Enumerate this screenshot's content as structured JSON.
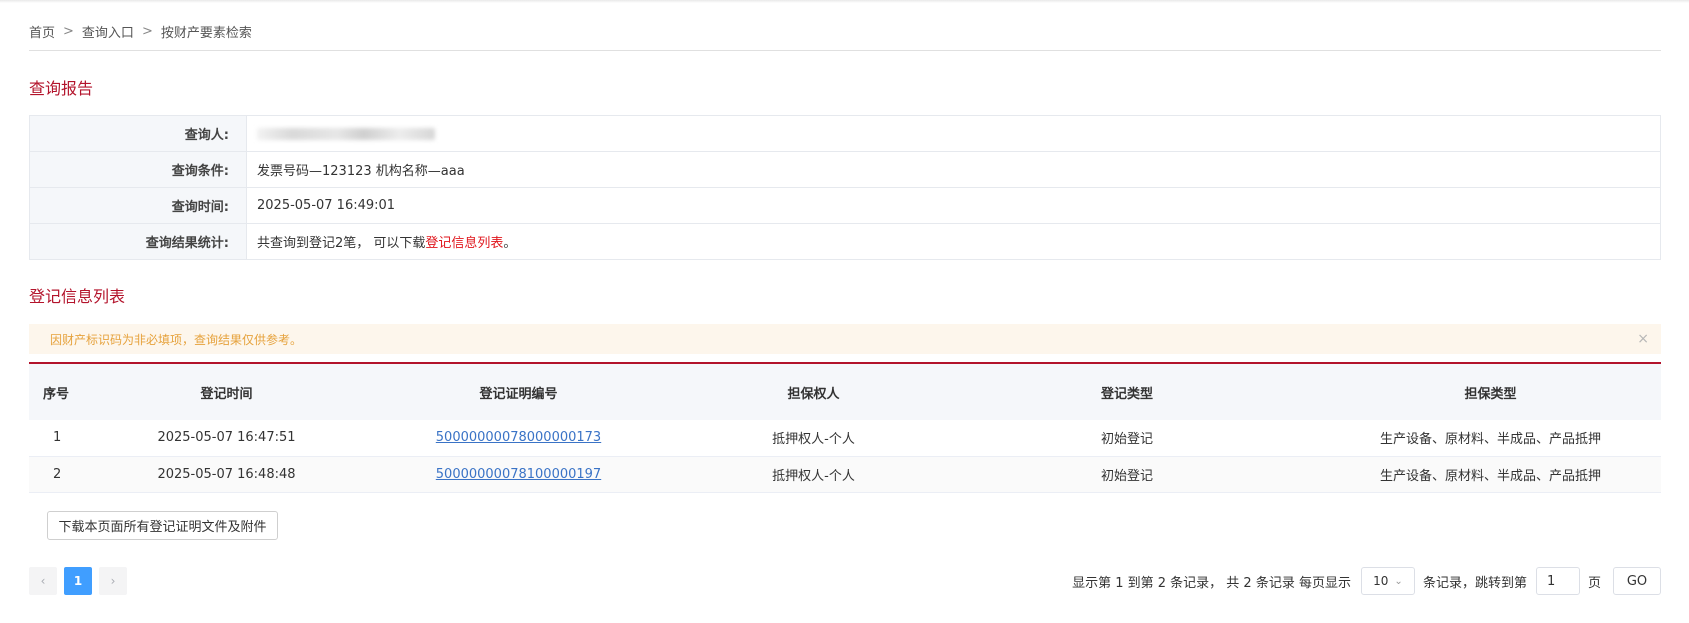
{
  "breadcrumb": {
    "home": "首页",
    "sep": ">",
    "entry": "查询入口",
    "current": "按财产要素检索"
  },
  "report": {
    "title": "查询报告",
    "rows": [
      {
        "key": "查询人:",
        "value": ""
      },
      {
        "key": "查询条件:",
        "value": "发票号码—123123 机构名称—aaa"
      },
      {
        "key": "查询时间:",
        "value": "2025-05-07 16:49:01"
      },
      {
        "key": "查询结果统计:",
        "value_prefix": "共查询到登记2笔， 可以下载",
        "value_link": "登记信息列表",
        "value_suffix": "。"
      }
    ]
  },
  "list": {
    "title": "登记信息列表",
    "alert": "因财产标识码为非必填项，查询结果仅供参考。",
    "alert_close": "×",
    "headers": [
      "序号",
      "登记时间",
      "登记证明编号",
      "担保权人",
      "登记类型",
      "担保类型"
    ],
    "rows": [
      [
        "1",
        "2025-05-07 16:47:51",
        "50000000078000000173",
        "抵押权人-个人",
        "初始登记",
        "生产设备、原材料、半成品、产品抵押"
      ],
      [
        "2",
        "2025-05-07 16:48:48",
        "50000000078100000197",
        "抵押权人-个人",
        "初始登记",
        "生产设备、原材料、半成品、产品抵押"
      ]
    ]
  },
  "download_button": "下载本页面所有登记证明文件及附件",
  "pagination": {
    "prev": "‹",
    "page": "1",
    "next": "›",
    "summary": "显示第 1 到第 2 条记录， 共 2 条记录 每页显示",
    "page_size": "10",
    "after_size": "条记录，跳转到第",
    "jump_value": "1",
    "page_unit": "页",
    "go": "GO"
  },
  "colors": {
    "accent": "#b3132b",
    "link": "#3a73c6",
    "alert_text": "#e6a23c",
    "active_page": "#409eff"
  }
}
